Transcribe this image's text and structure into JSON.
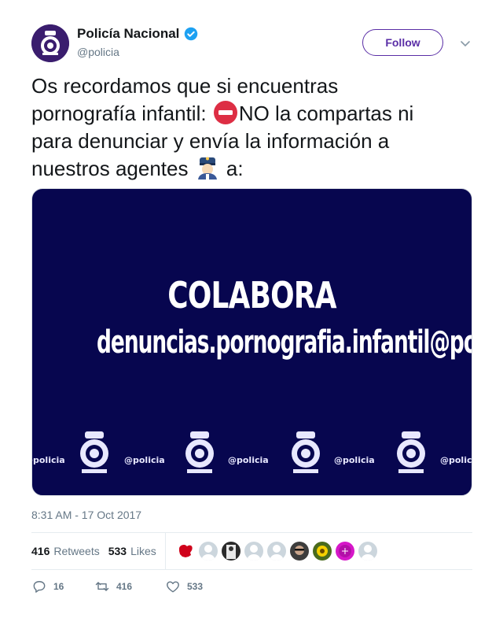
{
  "header": {
    "display_name": "Policía Nacional",
    "handle": "@policia",
    "follow_label": "Follow"
  },
  "tweet": {
    "lines": [
      "Os recordamos que si encuentras",
      "pornografía infantil: ",
      "NO la compartas ni",
      "para denunciar y envía la información a",
      "nuestros agentes ",
      " a:"
    ],
    "emojis": [
      "no-entry-icon",
      "police-officer-icon"
    ]
  },
  "media": {
    "headline": "COLABORA",
    "email": "denuncias.pornografia.infantil@policia.es",
    "watermark": "@policia",
    "background_color": "#07064f"
  },
  "timestamp": "8:31 AM - 17 Oct 2017",
  "stats": {
    "retweets_count": "416",
    "retweets_label": "Retweets",
    "likes_count": "533",
    "likes_label": "Likes",
    "liker_avatars": 9
  },
  "actions": {
    "replies": "16",
    "retweets": "416",
    "likes": "533"
  },
  "colors": {
    "accent": "#5a2ea6",
    "verified": "#1da1f2",
    "muted_text": "#657786"
  }
}
